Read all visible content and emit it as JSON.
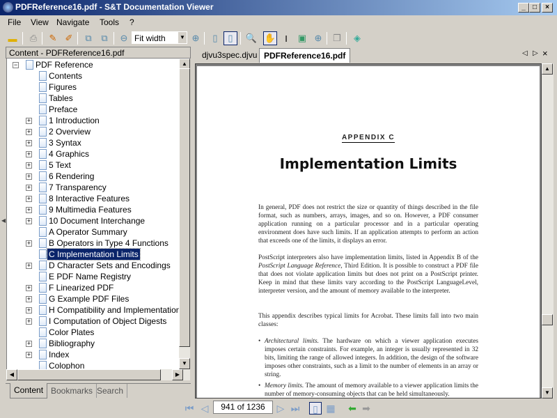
{
  "window": {
    "title": "PDFReference16.pdf - S&T Documentation Viewer",
    "controls": [
      "_",
      "□",
      "×"
    ]
  },
  "menu": [
    "File",
    "View",
    "Navigate",
    "Tools",
    "?"
  ],
  "toolbar": {
    "zoom_value": "Fit width"
  },
  "left_pane": {
    "header": "Content - PDFReference16.pdf",
    "tree": [
      {
        "label": "PDF Reference",
        "level": 0,
        "expandable": true,
        "expanded": true
      },
      {
        "label": "Contents",
        "level": 1,
        "expandable": false
      },
      {
        "label": "Figures",
        "level": 1,
        "expandable": false
      },
      {
        "label": "Tables",
        "level": 1,
        "expandable": false
      },
      {
        "label": "Preface",
        "level": 1,
        "expandable": false
      },
      {
        "label": "1 Introduction",
        "level": 1,
        "expandable": true
      },
      {
        "label": "2 Overview",
        "level": 1,
        "expandable": true
      },
      {
        "label": "3 Syntax",
        "level": 1,
        "expandable": true
      },
      {
        "label": "4 Graphics",
        "level": 1,
        "expandable": true
      },
      {
        "label": "5 Text",
        "level": 1,
        "expandable": true
      },
      {
        "label": "6 Rendering",
        "level": 1,
        "expandable": true
      },
      {
        "label": "7 Transparency",
        "level": 1,
        "expandable": true
      },
      {
        "label": "8 Interactive Features",
        "level": 1,
        "expandable": true
      },
      {
        "label": "9 Multimedia Features",
        "level": 1,
        "expandable": true
      },
      {
        "label": "10 Document Interchange",
        "level": 1,
        "expandable": true
      },
      {
        "label": "A Operator Summary",
        "level": 1,
        "expandable": false
      },
      {
        "label": "B Operators in Type 4 Functions",
        "level": 1,
        "expandable": true
      },
      {
        "label": "C Implementation Limits",
        "level": 1,
        "expandable": false,
        "selected": true
      },
      {
        "label": "D Character Sets and Encodings",
        "level": 1,
        "expandable": true
      },
      {
        "label": "E PDF Name Registry",
        "level": 1,
        "expandable": false
      },
      {
        "label": "F Linearized PDF",
        "level": 1,
        "expandable": true
      },
      {
        "label": "G Example PDF Files",
        "level": 1,
        "expandable": true
      },
      {
        "label": "H Compatibility and Implementation Notes",
        "level": 1,
        "expandable": true
      },
      {
        "label": "I Computation of Object Digests",
        "level": 1,
        "expandable": true
      },
      {
        "label": "Color Plates",
        "level": 1,
        "expandable": false
      },
      {
        "label": "Bibliography",
        "level": 1,
        "expandable": true
      },
      {
        "label": "Index",
        "level": 1,
        "expandable": true
      },
      {
        "label": "Colophon",
        "level": 1,
        "expandable": false
      }
    ],
    "tabs": [
      "Content",
      "Bookmarks",
      "Search"
    ],
    "active_tab": "Content"
  },
  "doc_tabs": [
    "djvu3spec.djvu",
    "PDFReference16.pdf"
  ],
  "active_doc_tab": "PDFReference16.pdf",
  "page": {
    "appendix": "APPENDIX C",
    "title": "Implementation Limits",
    "p1": "In general, PDF does not restrict the size or quantity of things described in the file format, such as numbers, arrays, images, and so on. However, a PDF consumer application running on a particular processor and in a particular operating environment does have such limits. If an application attempts to perform an action that exceeds one of the limits, it displays an error.",
    "p2a": "PostScript interpreters also have implementation limits, listed in Appendix B of the ",
    "p2i": "PostScript Language Reference",
    "p2b": ", Third Edition. It is possible to construct a PDF file that does not violate application limits but does not print on a PostScript printer. Keep in mind that these limits vary according to the PostScript LanguageLevel, interpreter version, and the amount of memory available to the interpreter.",
    "p3": "This appendix describes typical limits for Acrobat. These limits fall into two main classes:",
    "b1i": "Architectural limits.",
    "b1": " The hardware on which a viewer application executes imposes certain constraints. For example, an integer is usually represented in 32 bits, limiting the range of allowed integers. In addition, the design of the software imposes other constraints, such as a limit to the number of elements in an array or string.",
    "b2i": "Memory limits.",
    "b2": " The amount of memory available to a viewer application limits the number of memory-consuming objects that can be held simultaneously."
  },
  "navigation": {
    "page_indicator": "941 of 1236"
  }
}
